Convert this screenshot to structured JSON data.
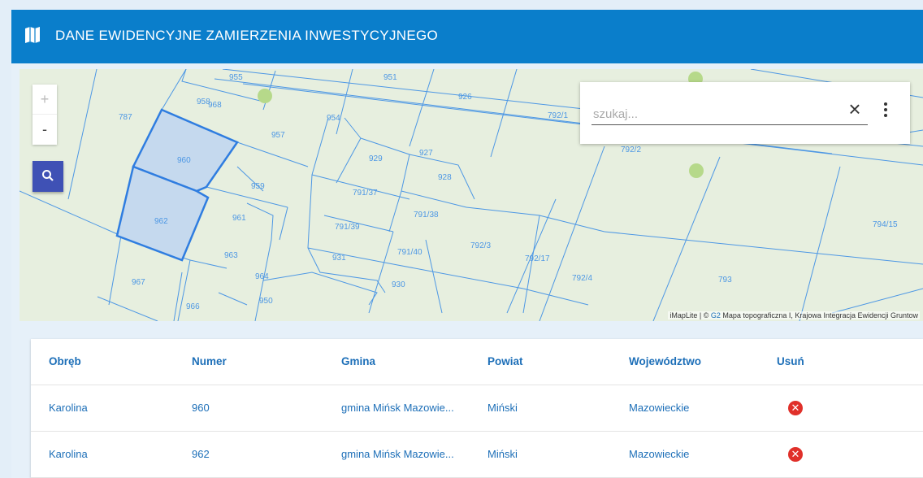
{
  "header": {
    "title": "DANE EWIDENCYJNE ZAMIERZENIA INWESTYCYJNEGO",
    "icon": "map-icon"
  },
  "map": {
    "zoom_in": "+",
    "zoom_out": "-",
    "search_placeholder": "szukaj...",
    "clear_label": "×",
    "attribution_prefix": "iMapLite | © ",
    "attribution_g2": "G2",
    "attribution_suffix": " Mapa topograficzna I, Krajowa Integracja Ewidencji Gruntow",
    "parcel_labels": [
      "955",
      "951",
      "958",
      "968",
      "954",
      "926",
      "792/1",
      "787",
      "957",
      "960",
      "929",
      "927",
      "928",
      "792/2",
      "959",
      "791/37",
      "962",
      "961",
      "791/38",
      "791/39",
      "794/15",
      "792/3",
      "791/40",
      "963",
      "931",
      "792/17",
      "792/4",
      "964",
      "930",
      "967",
      "793",
      "950",
      "966"
    ],
    "selected_parcels": [
      "960",
      "962"
    ],
    "colors": {
      "map_bg": "#e7efdf",
      "parcel_line": "#3d8fe0",
      "selected_fill": "#c5d9ee",
      "selected_stroke": "#2f7de0",
      "label": "#3d8fe0"
    }
  },
  "table": {
    "headers": [
      "Obręb",
      "Numer",
      "Gmina",
      "Powiat",
      "Województwo",
      "Usuń"
    ],
    "rows": [
      {
        "obreb": "Karolina",
        "numer": "960",
        "gmina": "gmina Mińsk Mazowie...",
        "powiat": "Miński",
        "wojewodztwo": "Mazowieckie"
      },
      {
        "obreb": "Karolina",
        "numer": "962",
        "gmina": "gmina Mińsk Mazowie...",
        "powiat": "Miński",
        "wojewodztwo": "Mazowieckie"
      }
    ],
    "delete_icon": "delete-icon",
    "colors": {
      "header_text": "#1d6fb8",
      "delete": "#e0302a"
    }
  }
}
